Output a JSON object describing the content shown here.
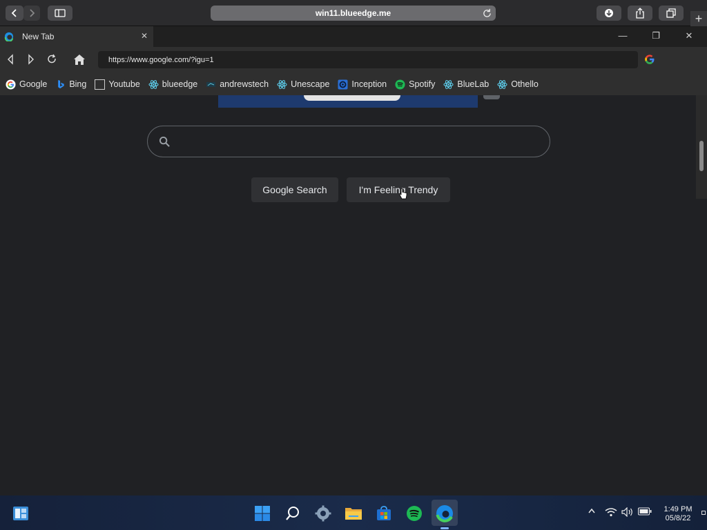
{
  "safari": {
    "url": "win11.blueedge.me"
  },
  "tab": {
    "title": "New Tab"
  },
  "address": {
    "url": "https://www.google.com/?igu=1"
  },
  "bookmarks": [
    {
      "label": "Google",
      "icon": "google-icon"
    },
    {
      "label": "Bing",
      "icon": "bing-icon"
    },
    {
      "label": "Youtube",
      "icon": "blank-page-icon"
    },
    {
      "label": "blueedge",
      "icon": "react-atom-icon"
    },
    {
      "label": "andrewstech",
      "icon": "andrewstech-icon"
    },
    {
      "label": "Unescape",
      "icon": "react-atom-icon"
    },
    {
      "label": "Inception",
      "icon": "inception-icon"
    },
    {
      "label": "Spotify",
      "icon": "spotify-icon"
    },
    {
      "label": "BlueLab",
      "icon": "react-atom-icon"
    },
    {
      "label": "Othello",
      "icon": "react-atom-icon"
    }
  ],
  "google": {
    "search_placeholder": "",
    "search_button": "Google Search",
    "lucky_button": "I'm Feeling Trendy"
  },
  "taskbar": {
    "apps": [
      "windows-start-icon",
      "search-icon",
      "settings-gear-icon",
      "file-explorer-icon",
      "microsoft-store-icon",
      "spotify-icon",
      "edge-icon"
    ],
    "time": "1:49 PM",
    "date": "05/8/22"
  },
  "colors": {
    "page_bg": "#202124",
    "chrome_bg": "#2f2f2f",
    "accent": "#0a84ff"
  }
}
